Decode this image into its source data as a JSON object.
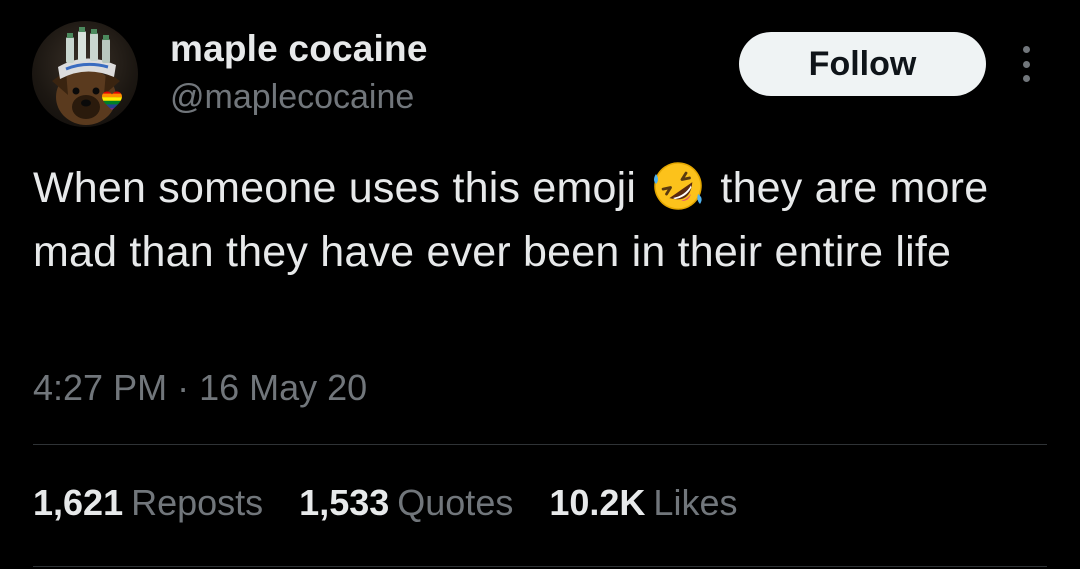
{
  "user": {
    "display_name": "maple cocaine",
    "handle": "@maplecocaine",
    "avatar_icon": "dog-with-hat-avatar",
    "badge_icon": "pride-heart-icon"
  },
  "actions": {
    "follow_label": "Follow",
    "more_icon": "more-options-icon"
  },
  "tweet": {
    "text_part1": "When someone uses this emoji",
    "emoji": "rolling-on-floor-laughing-emoji",
    "text_part2": "they are more mad than they have ever been in their entire life",
    "time": "4:27 PM",
    "separator": "·",
    "date": "16 May 20"
  },
  "stats": {
    "reposts_count": "1,621",
    "reposts_label": "Reposts",
    "quotes_count": "1,533",
    "quotes_label": "Quotes",
    "likes_count": "10.2K",
    "likes_label": "Likes"
  },
  "colors": {
    "background": "#000000",
    "text_primary": "#e7e9ea",
    "text_secondary": "#71767b",
    "follow_bg": "#eff3f4",
    "divider": "#2f3336"
  }
}
